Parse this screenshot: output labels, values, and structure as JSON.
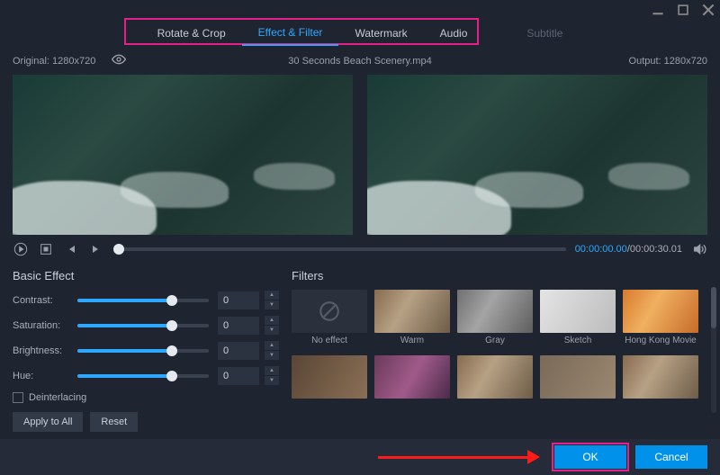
{
  "window": {
    "minimize": "min",
    "maximize": "max",
    "close": "close"
  },
  "tabs": {
    "items": [
      {
        "label": "Rotate & Crop"
      },
      {
        "label": "Effect & Filter"
      },
      {
        "label": "Watermark"
      },
      {
        "label": "Audio"
      },
      {
        "label": "Subtitle"
      }
    ]
  },
  "info": {
    "original_label": "Original: 1280x720",
    "filename": "30 Seconds Beach Scenery.mp4",
    "output_label": "Output: 1280x720"
  },
  "playbar": {
    "current": "00:00:00.00",
    "sep": "/",
    "total": "00:00:30.01"
  },
  "basic": {
    "title": "Basic Effect",
    "rows": [
      {
        "label": "Contrast:",
        "value": "0"
      },
      {
        "label": "Saturation:",
        "value": "0"
      },
      {
        "label": "Brightness:",
        "value": "0"
      },
      {
        "label": "Hue:",
        "value": "0"
      }
    ],
    "deinterlacing": "Deinterlacing",
    "apply_all": "Apply to All",
    "reset": "Reset"
  },
  "filters": {
    "title": "Filters",
    "items": [
      {
        "label": "No effect"
      },
      {
        "label": "Warm"
      },
      {
        "label": "Gray"
      },
      {
        "label": "Sketch"
      },
      {
        "label": "Hong Kong Movie"
      },
      {
        "label": ""
      },
      {
        "label": ""
      },
      {
        "label": ""
      },
      {
        "label": ""
      },
      {
        "label": ""
      }
    ]
  },
  "footer": {
    "ok": "OK",
    "cancel": "Cancel"
  }
}
